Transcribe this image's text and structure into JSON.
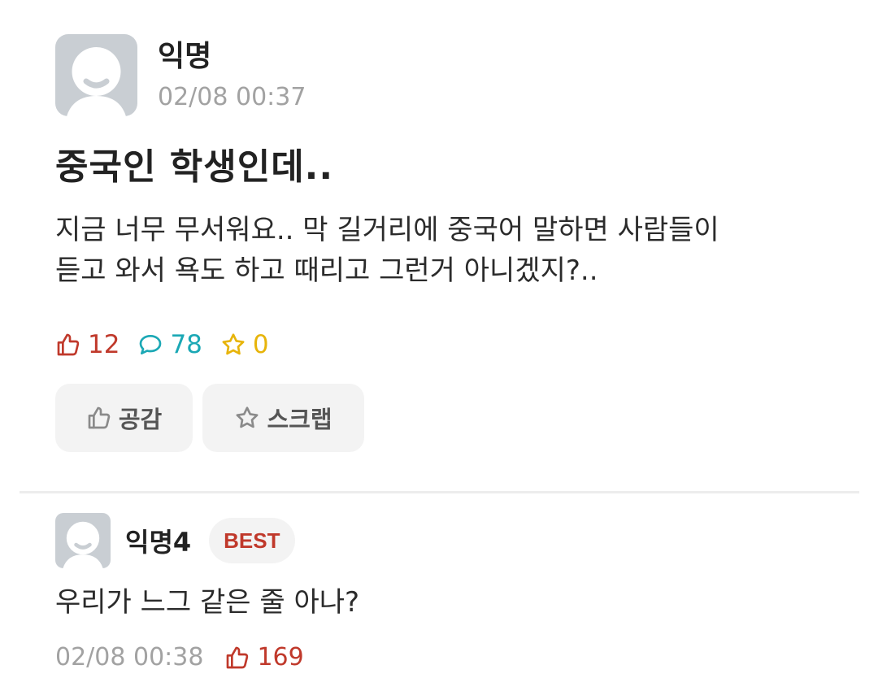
{
  "post": {
    "author": "익명",
    "time": "02/08 00:37",
    "title": "중국인 학생인데..",
    "body_lines": [
      "지금 너무 무서워요.. 막 길거리에 중국어 말하면 사람들이",
      "듣고 와서 욕도 하고 때리고 그런거 아니겠지?.."
    ],
    "stats": {
      "likes": "12",
      "comments": "78",
      "scraps": "0"
    },
    "actions": {
      "like_label": "공감",
      "scrap_label": "스크랩"
    }
  },
  "comment": {
    "author": "익명4",
    "badge": "BEST",
    "text": "우리가 느그 같은 줄 아나?",
    "time": "02/08 00:38",
    "likes": "169"
  },
  "colors": {
    "like": "#c0392b",
    "comment": "#1ba8b5",
    "scrap": "#e7b40a",
    "muted": "#a2a2a2"
  },
  "icons": {
    "avatar": "default-avatar-icon",
    "like": "thumbs-up-icon",
    "comment": "speech-bubble-icon",
    "scrap": "star-icon"
  }
}
